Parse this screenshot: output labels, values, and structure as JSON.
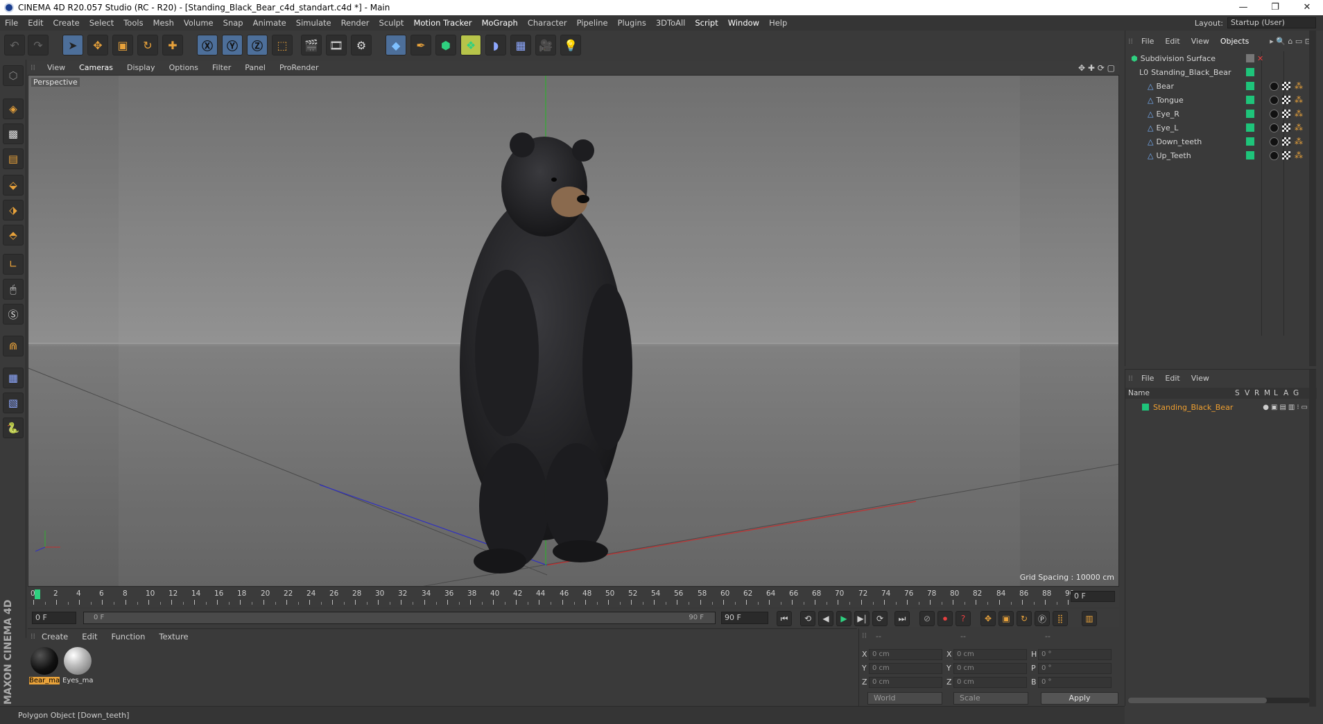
{
  "window": {
    "title": "CINEMA 4D R20.057 Studio (RC - R20) - [Standing_Black_Bear_c4d_standart.c4d *] - Main",
    "controls": [
      "—",
      "❐",
      "✕"
    ]
  },
  "menubar": {
    "items": [
      "File",
      "Edit",
      "Create",
      "Select",
      "Tools",
      "Mesh",
      "Volume",
      "Snap",
      "Animate",
      "Simulate",
      "Render",
      "Sculpt",
      "Motion Tracker",
      "MoGraph",
      "Character",
      "Pipeline",
      "Plugins",
      "3DToAll",
      "Script",
      "Window",
      "Help"
    ],
    "layout_label": "Layout:",
    "layout_value": "Startup (User)"
  },
  "viewport": {
    "menu": [
      "View",
      "Cameras",
      "Display",
      "Options",
      "Filter",
      "Panel",
      "ProRender"
    ],
    "camera_label": "Perspective",
    "grid_spacing": "Grid Spacing : 10000 cm"
  },
  "timeline": {
    "ticks": [
      "0",
      "2",
      "4",
      "6",
      "8",
      "10",
      "12",
      "14",
      "16",
      "18",
      "20",
      "22",
      "24",
      "26",
      "28",
      "30",
      "32",
      "34",
      "36",
      "38",
      "40",
      "42",
      "44",
      "46",
      "48",
      "50",
      "52",
      "54",
      "56",
      "58",
      "60",
      "62",
      "64",
      "66",
      "68",
      "70",
      "72",
      "74",
      "76",
      "78",
      "80",
      "82",
      "84",
      "86",
      "88",
      "90"
    ],
    "current_frame": "0 F",
    "start_frame": "0 F",
    "range_start": "0 F",
    "range_end": "90 F",
    "end_frame": "90 F"
  },
  "materials": {
    "menu": [
      "Create",
      "Edit",
      "Function",
      "Texture"
    ],
    "items": [
      {
        "label": "Bear_ma",
        "selected": true
      },
      {
        "label": "Eyes_ma",
        "selected": false
      }
    ]
  },
  "coords": {
    "header": [
      "--",
      "--",
      "--"
    ],
    "pos": [
      {
        "axis": "X",
        "value": "0 cm"
      },
      {
        "axis": "Y",
        "value": "0 cm"
      },
      {
        "axis": "Z",
        "value": "0 cm"
      }
    ],
    "size": [
      {
        "axis": "X",
        "value": "0 cm"
      },
      {
        "axis": "Y",
        "value": "0 cm"
      },
      {
        "axis": "Z",
        "value": "0 cm"
      }
    ],
    "rot": [
      {
        "axis": "H",
        "value": "0 °"
      },
      {
        "axis": "P",
        "value": "0 °"
      },
      {
        "axis": "B",
        "value": "0 °"
      }
    ],
    "mode": "World",
    "scale_mode": "Scale",
    "apply": "Apply"
  },
  "status": "Polygon Object [Down_teeth]",
  "brand": "MAXON CINEMA 4D",
  "objects": {
    "menu": [
      "File",
      "Edit",
      "View",
      "Objects"
    ],
    "items": [
      {
        "name": "Subdivision Surface",
        "indent": 0
      },
      {
        "name": "Standing_Black_Bear",
        "indent": 1
      },
      {
        "name": "Bear",
        "indent": 2
      },
      {
        "name": "Tongue",
        "indent": 2
      },
      {
        "name": "Eye_R",
        "indent": 2
      },
      {
        "name": "Eye_L",
        "indent": 2
      },
      {
        "name": "Down_teeth",
        "indent": 2
      },
      {
        "name": "Up_Teeth",
        "indent": 2
      }
    ]
  },
  "layers": {
    "menu": [
      "File",
      "Edit",
      "View"
    ],
    "columns": [
      "Name",
      "S",
      "V",
      "R",
      "M",
      "L",
      "A",
      "G"
    ],
    "items": [
      {
        "name": "Standing_Black_Bear"
      }
    ]
  },
  "colors": {
    "accent": "#e8a23b",
    "selected_text": "#f0a030",
    "object_green": "#1ec47a",
    "x_axis": "#c23030",
    "y_axis": "#2fae2f",
    "z_axis": "#3040c0"
  }
}
